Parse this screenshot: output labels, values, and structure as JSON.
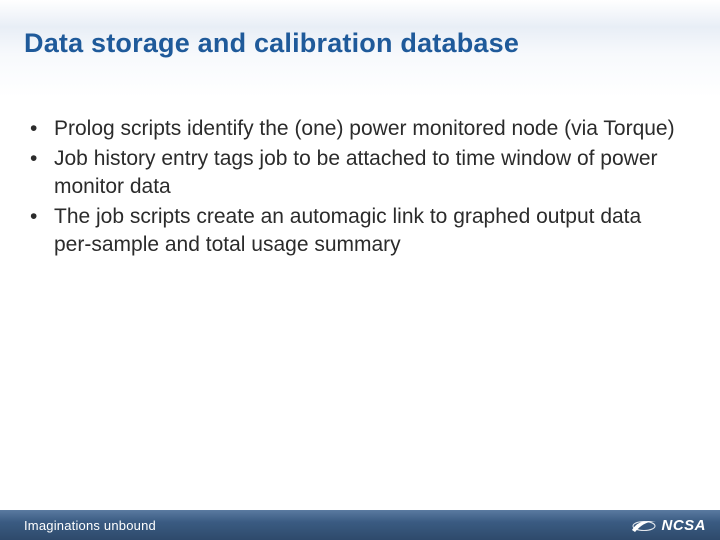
{
  "title": "Data storage and calibration database",
  "bullets": [
    "Prolog scripts identify the (one) power monitored node (via Torque)",
    "Job history entry tags job to be attached to time window of power monitor data",
    "The job scripts create an automagic link to graphed output data per-sample and total usage summary"
  ],
  "footer": {
    "tagline": "Imaginations unbound",
    "logo_text": "NCSA"
  }
}
